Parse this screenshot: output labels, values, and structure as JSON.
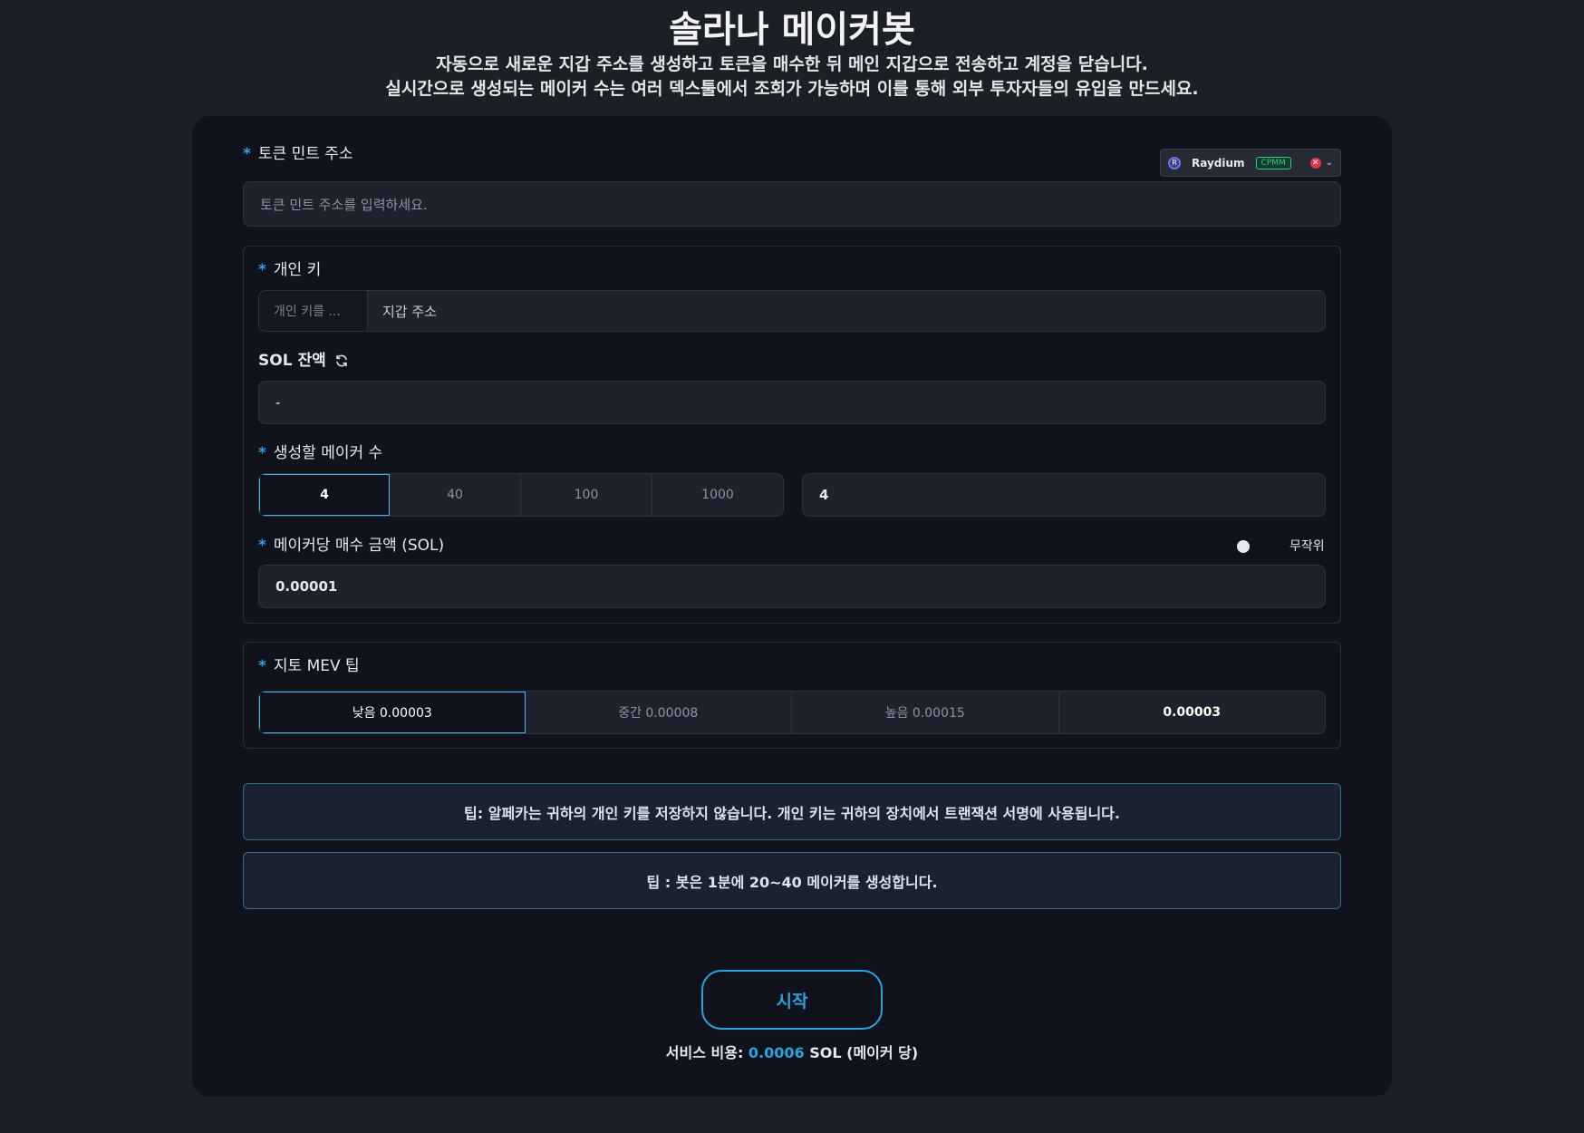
{
  "header": {
    "title": "솔라나 메이커봇",
    "subtitle_line1": "자동으로 새로운 지갑 주소를 생성하고 토큰을 매수한 뒤 메인 지갑으로 전송하고 계정을 닫습니다.",
    "subtitle_line2": "실시간으로 생성되는 메이커 수는 여러 덱스툴에서 조회가 가능하며 이를 통해 외부 투자자들의 유입을 만드세요."
  },
  "token": {
    "required_mark": "*",
    "label": "토큰 민트 주소",
    "placeholder": "토큰 민트 주소를 입력하세요.",
    "dex": {
      "name": "Raydium",
      "tag": "CPMM",
      "clear_icon": "x-circle-icon",
      "chevron_icon": "chevron-down-icon"
    }
  },
  "wallet": {
    "required_mark": "*",
    "private_key_label": "개인 키",
    "private_key_placeholder": "개인 키를 ...",
    "wallet_address_placeholder": "지갑 주소",
    "balance_label": "SOL 잔액",
    "refresh_icon": "refresh-icon",
    "balance_value": "-"
  },
  "makers": {
    "required_mark": "*",
    "label": "생성할 메이커 수",
    "options": [
      "4",
      "40",
      "100",
      "1000"
    ],
    "selected": "4",
    "custom_value": "4"
  },
  "buy_amount": {
    "required_mark": "*",
    "label": "메이커당 매수 금액 (SOL)",
    "random_label": "무작위",
    "value": "0.00001"
  },
  "jito": {
    "required_mark": "*",
    "label": "지토 MEV 팁",
    "options": [
      "낮음 0.00003",
      "중간 0.00008",
      "높음 0.00015"
    ],
    "selected": "낮음 0.00003",
    "current_value": "0.00003"
  },
  "tips": [
    "팁: 알페카는 귀하의 개인 키를 저장하지 않습니다. 개인 키는 귀하의 장치에서 트랜잭션 서명에 사용됩니다.",
    "팁 : 봇은 1분에 20~40 메이커를 생성합니다."
  ],
  "start_button": "시작",
  "fee": {
    "prefix": "서비스 비용: ",
    "amount": "0.0006",
    "suffix": " SOL (메이커 당)"
  },
  "colors": {
    "background": "#1c1f26",
    "card": "#10131b",
    "accent": "#2aa3e0",
    "tag_green": "#2ecb8a",
    "clear_red": "#e0334a"
  }
}
